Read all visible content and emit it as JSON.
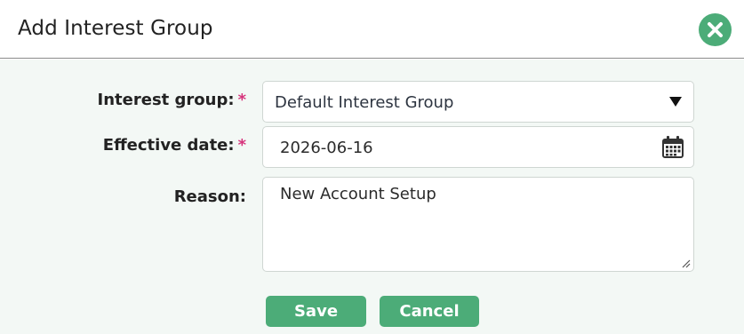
{
  "dialog": {
    "title": "Add Interest Group",
    "close_icon": "close-icon"
  },
  "form": {
    "interest_group": {
      "label": "Interest group:",
      "required_mark": "*",
      "selected_value": "Default Interest Group",
      "icon": "caret-down-icon"
    },
    "effective_date": {
      "label": "Effective date:",
      "required_mark": "*",
      "value": "2026-06-16",
      "icon": "calendar-icon"
    },
    "reason": {
      "label": "Reason:",
      "value": "New Account Setup",
      "icon": "resize-grip-icon"
    }
  },
  "actions": {
    "save_label": "Save",
    "cancel_label": "Cancel"
  },
  "colors": {
    "accent": "#4cac78",
    "required": "#d6337b",
    "body_background": "#f3f8f5"
  }
}
